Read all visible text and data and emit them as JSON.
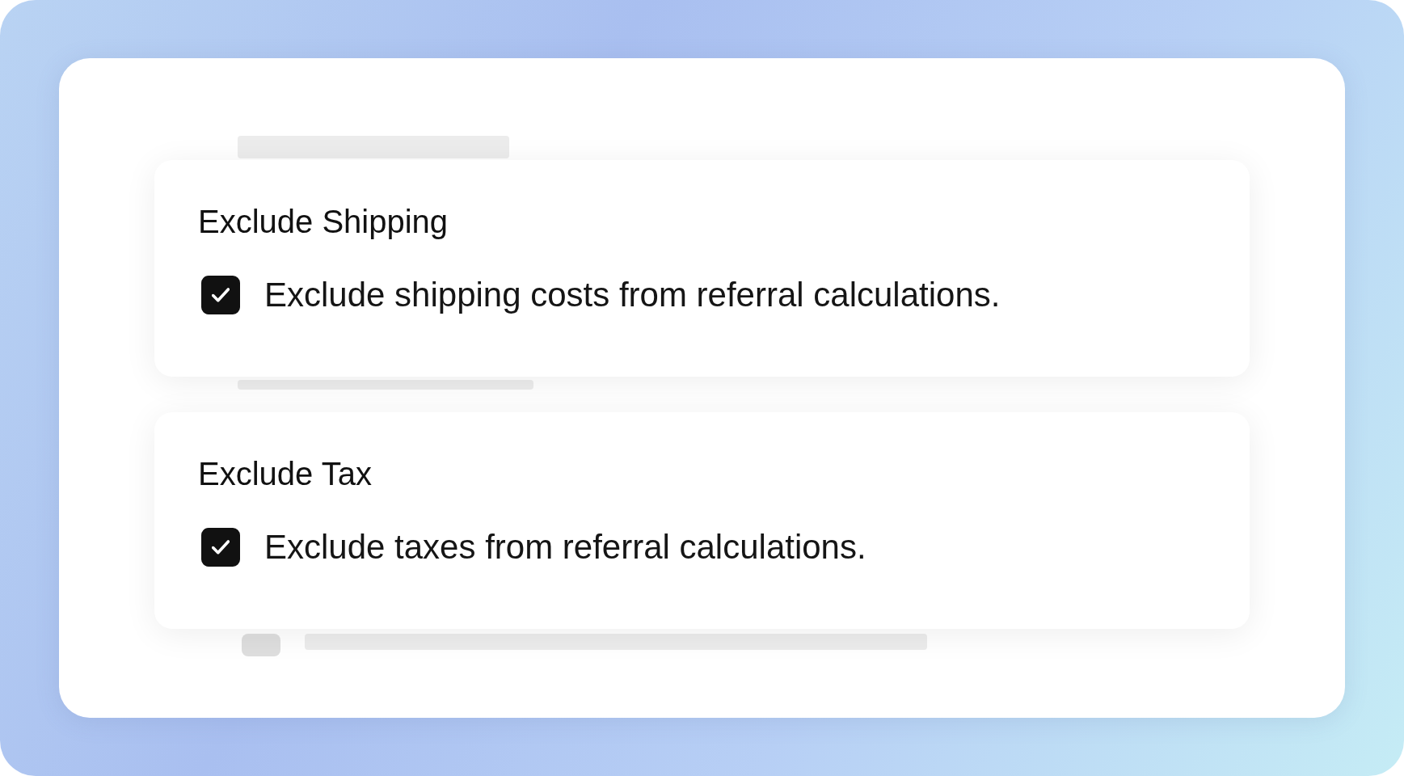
{
  "cards": [
    {
      "title": "Exclude Shipping",
      "option": {
        "label": "Exclude shipping costs from referral calculations.",
        "checked": true
      }
    },
    {
      "title": "Exclude Tax",
      "option": {
        "label": "Exclude taxes from referral calculations.",
        "checked": true
      }
    }
  ]
}
